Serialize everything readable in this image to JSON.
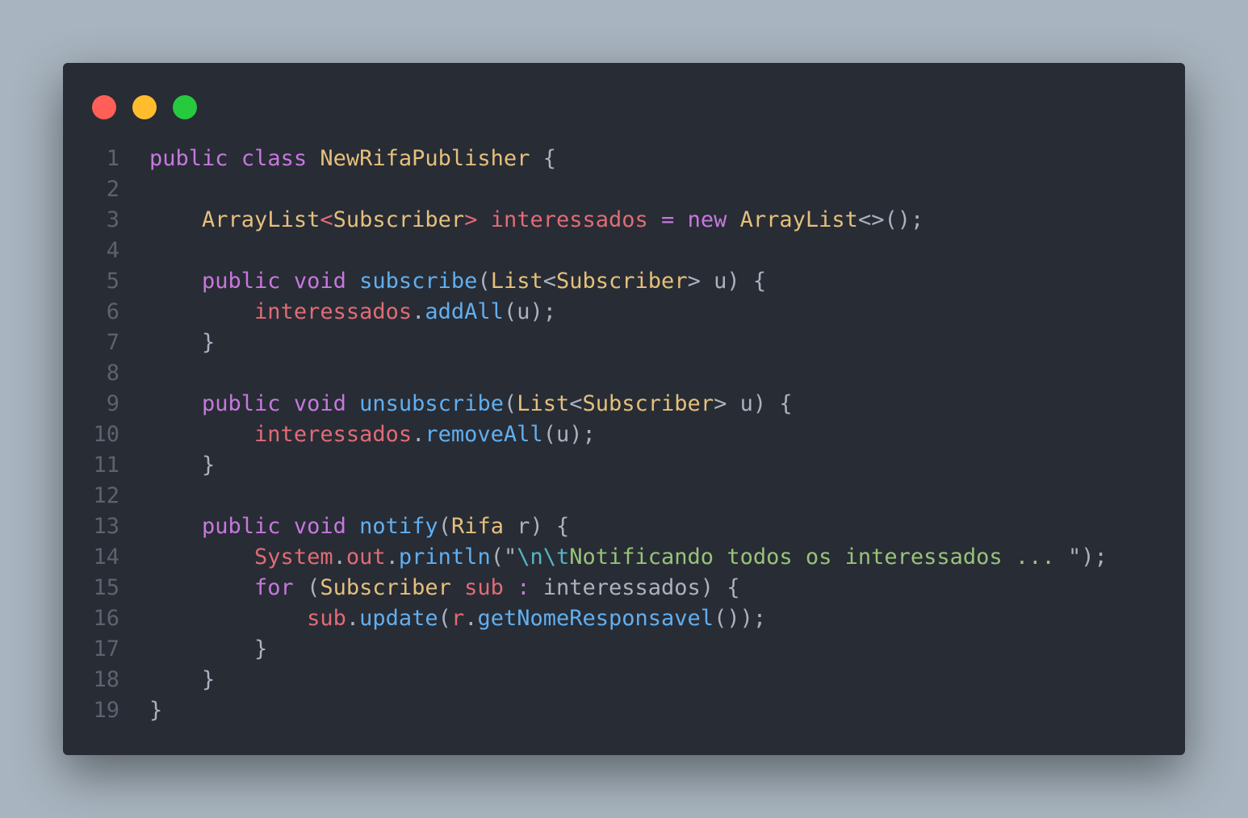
{
  "window": {
    "controls": [
      {
        "name": "close",
        "color": "#ff5f56"
      },
      {
        "name": "minimize",
        "color": "#ffbd2e"
      },
      {
        "name": "maximize",
        "color": "#27c93f"
      }
    ]
  },
  "code": {
    "language": "java",
    "lines": [
      {
        "n": "1",
        "tokens": [
          [
            "kw",
            "public"
          ],
          [
            "plain",
            " "
          ],
          [
            "kw",
            "class"
          ],
          [
            "plain",
            " "
          ],
          [
            "type",
            "NewRifaPublisher"
          ],
          [
            "plain",
            " {"
          ]
        ]
      },
      {
        "n": "2",
        "tokens": []
      },
      {
        "n": "3",
        "tokens": [
          [
            "plain",
            "    "
          ],
          [
            "type",
            "ArrayList"
          ],
          [
            "var",
            "<"
          ],
          [
            "type",
            "Subscriber"
          ],
          [
            "var",
            ">"
          ],
          [
            "plain",
            " "
          ],
          [
            "var",
            "interessados"
          ],
          [
            "plain",
            " "
          ],
          [
            "op",
            "="
          ],
          [
            "plain",
            " "
          ],
          [
            "kw",
            "new"
          ],
          [
            "plain",
            " "
          ],
          [
            "type",
            "ArrayList"
          ],
          [
            "plain",
            "<>();"
          ]
        ]
      },
      {
        "n": "4",
        "tokens": []
      },
      {
        "n": "5",
        "tokens": [
          [
            "plain",
            "    "
          ],
          [
            "kw",
            "public"
          ],
          [
            "plain",
            " "
          ],
          [
            "kw",
            "void"
          ],
          [
            "plain",
            " "
          ],
          [
            "fn",
            "subscribe"
          ],
          [
            "plain",
            "("
          ],
          [
            "type",
            "List"
          ],
          [
            "plain",
            "<"
          ],
          [
            "type",
            "Subscriber"
          ],
          [
            "plain",
            "> u) {"
          ]
        ]
      },
      {
        "n": "6",
        "tokens": [
          [
            "plain",
            "        "
          ],
          [
            "var",
            "interessados"
          ],
          [
            "plain",
            "."
          ],
          [
            "fn",
            "addAll"
          ],
          [
            "plain",
            "(u);"
          ]
        ]
      },
      {
        "n": "7",
        "tokens": [
          [
            "plain",
            "    }"
          ]
        ]
      },
      {
        "n": "8",
        "tokens": []
      },
      {
        "n": "9",
        "tokens": [
          [
            "plain",
            "    "
          ],
          [
            "kw",
            "public"
          ],
          [
            "plain",
            " "
          ],
          [
            "kw",
            "void"
          ],
          [
            "plain",
            " "
          ],
          [
            "fn",
            "unsubscribe"
          ],
          [
            "plain",
            "("
          ],
          [
            "type",
            "List"
          ],
          [
            "plain",
            "<"
          ],
          [
            "type",
            "Subscriber"
          ],
          [
            "plain",
            "> u) {"
          ]
        ]
      },
      {
        "n": "10",
        "tokens": [
          [
            "plain",
            "        "
          ],
          [
            "var",
            "interessados"
          ],
          [
            "plain",
            "."
          ],
          [
            "fn",
            "removeAll"
          ],
          [
            "plain",
            "(u);"
          ]
        ]
      },
      {
        "n": "11",
        "tokens": [
          [
            "plain",
            "    }"
          ]
        ]
      },
      {
        "n": "12",
        "tokens": []
      },
      {
        "n": "13",
        "tokens": [
          [
            "plain",
            "    "
          ],
          [
            "kw",
            "public"
          ],
          [
            "plain",
            " "
          ],
          [
            "kw",
            "void"
          ],
          [
            "plain",
            " "
          ],
          [
            "fn",
            "notify"
          ],
          [
            "plain",
            "("
          ],
          [
            "type",
            "Rifa"
          ],
          [
            "plain",
            " r) {"
          ]
        ]
      },
      {
        "n": "14",
        "tokens": [
          [
            "plain",
            "        "
          ],
          [
            "var",
            "System"
          ],
          [
            "plain",
            "."
          ],
          [
            "var",
            "out"
          ],
          [
            "plain",
            "."
          ],
          [
            "fn",
            "println"
          ],
          [
            "plain",
            "(\""
          ],
          [
            "esc",
            "\\n\\t"
          ],
          [
            "str",
            "Notificando todos os interessados ... "
          ],
          [
            "plain",
            "\");"
          ]
        ]
      },
      {
        "n": "15",
        "tokens": [
          [
            "plain",
            "        "
          ],
          [
            "kw",
            "for"
          ],
          [
            "plain",
            " ("
          ],
          [
            "type",
            "Subscriber"
          ],
          [
            "plain",
            " "
          ],
          [
            "var",
            "sub"
          ],
          [
            "plain",
            " "
          ],
          [
            "op",
            ":"
          ],
          [
            "plain",
            " interessados) {"
          ]
        ]
      },
      {
        "n": "16",
        "tokens": [
          [
            "plain",
            "            "
          ],
          [
            "var",
            "sub"
          ],
          [
            "plain",
            "."
          ],
          [
            "fn",
            "update"
          ],
          [
            "plain",
            "("
          ],
          [
            "var",
            "r"
          ],
          [
            "plain",
            "."
          ],
          [
            "fn",
            "getNomeResponsavel"
          ],
          [
            "plain",
            "());"
          ]
        ]
      },
      {
        "n": "17",
        "tokens": [
          [
            "plain",
            "        }"
          ]
        ]
      },
      {
        "n": "18",
        "tokens": [
          [
            "plain",
            "    }"
          ]
        ]
      },
      {
        "n": "19",
        "tokens": [
          [
            "plain",
            "}"
          ]
        ]
      }
    ]
  }
}
